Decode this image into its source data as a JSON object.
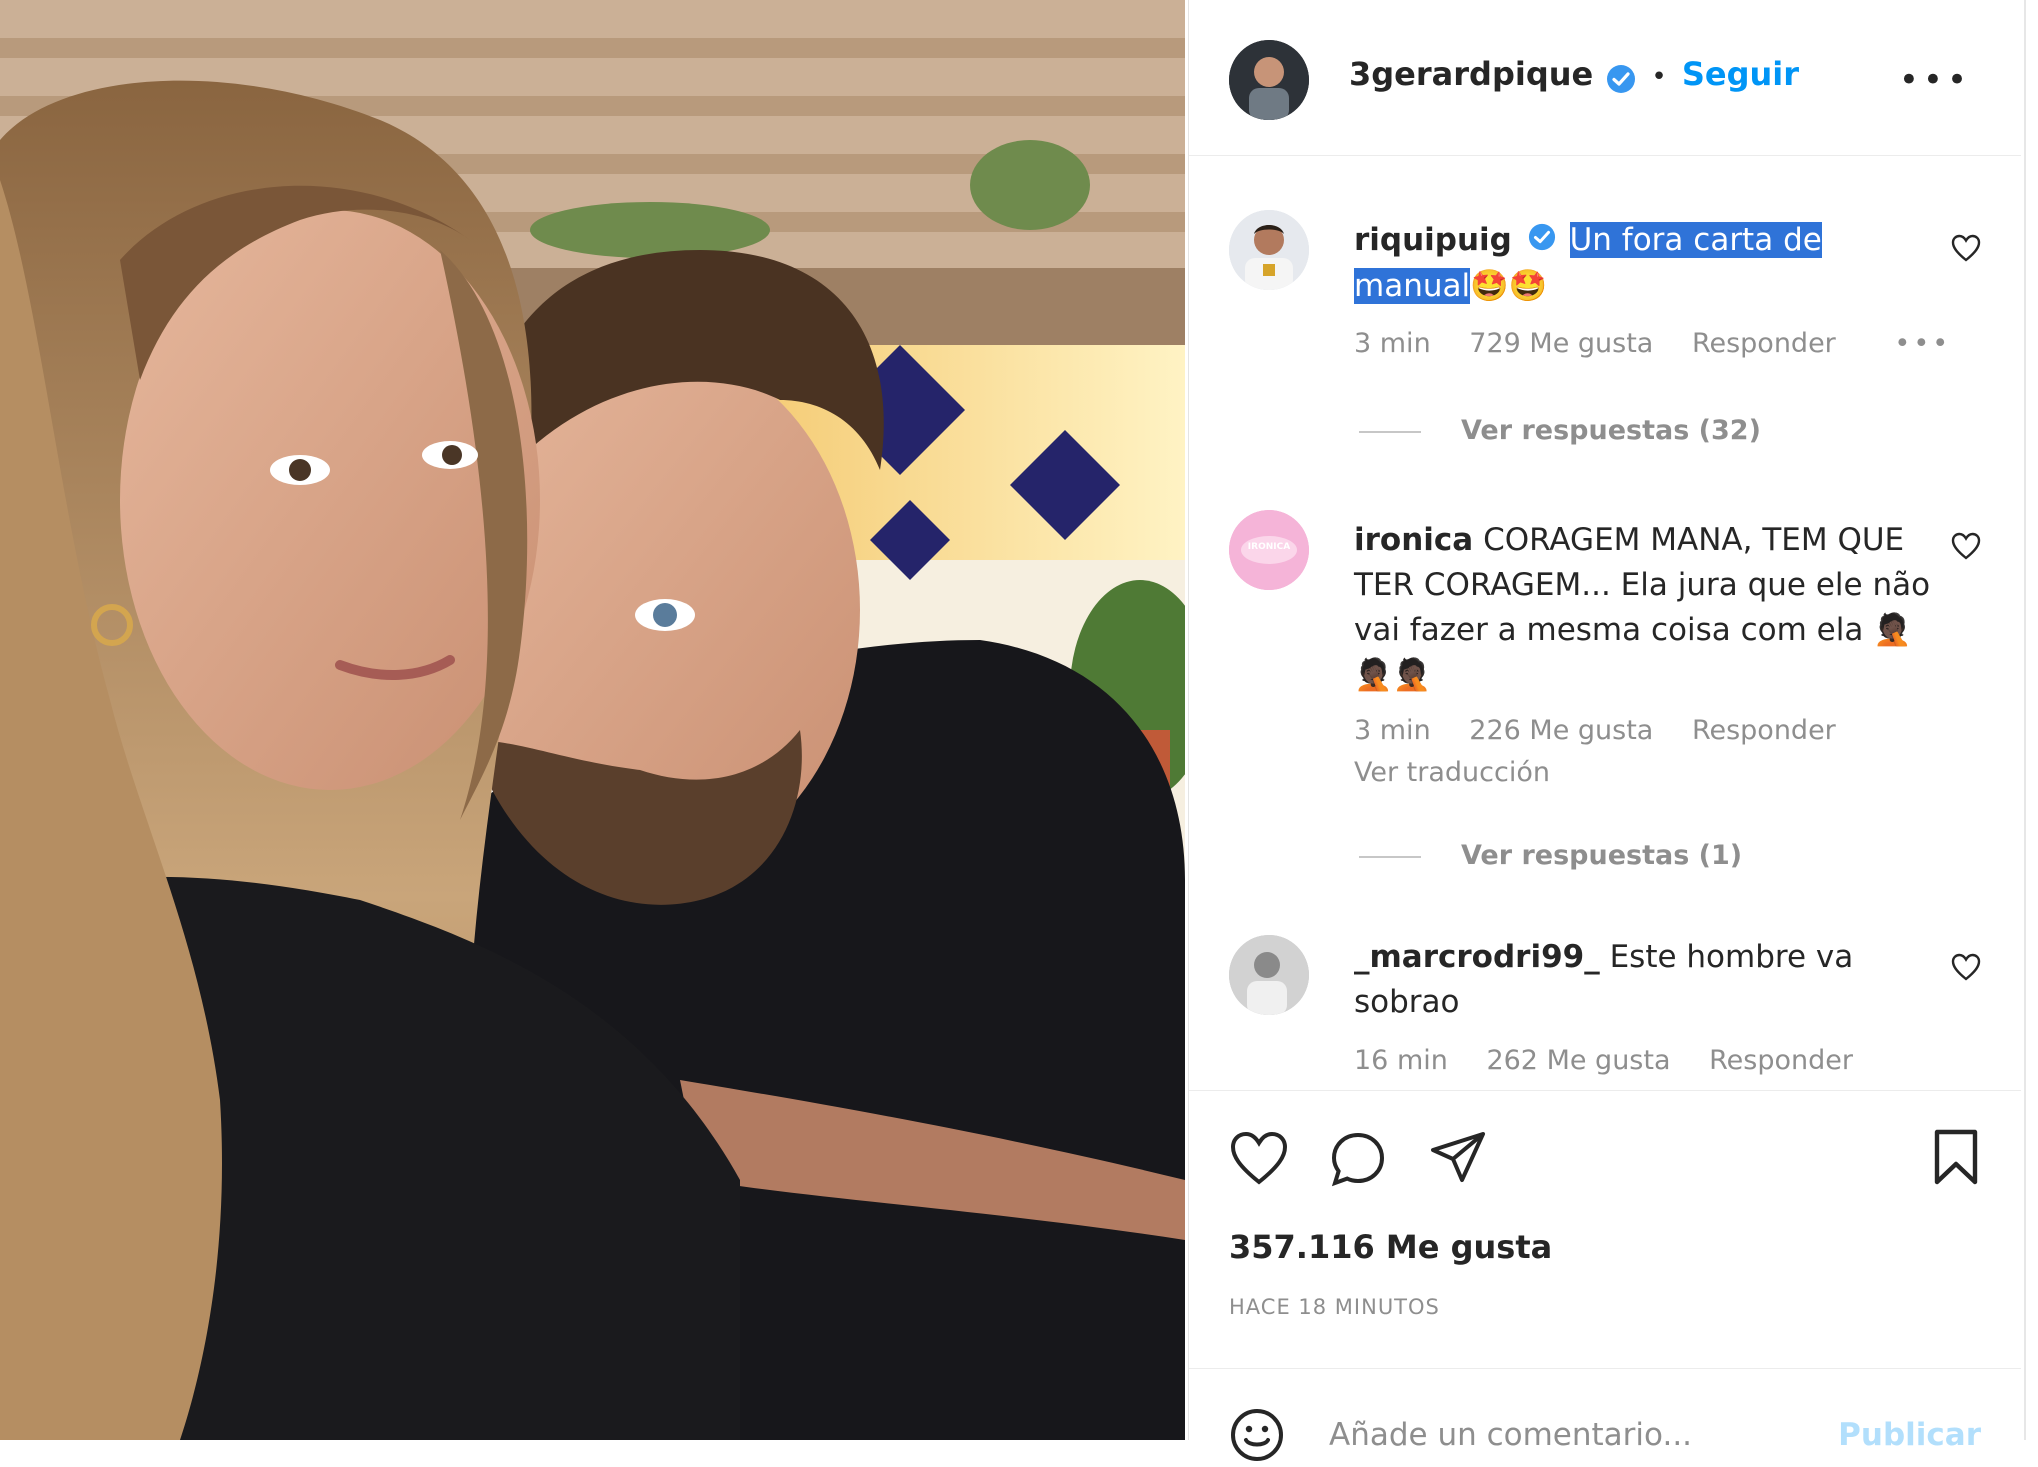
{
  "post": {
    "author": "3gerardpique",
    "follow_label": "Seguir",
    "separator": "•",
    "more_label": "•••"
  },
  "comments": [
    {
      "user": "riquipuig",
      "verified": true,
      "text_highlighted": "Un fora carta de manual",
      "text_rest": "🤩🤩",
      "time": "3 min",
      "likes": "729 Me gusta",
      "reply_label": "Responder",
      "more_label": "•••",
      "view_replies": "Ver respuestas (32)"
    },
    {
      "user": "ironica",
      "verified": false,
      "text": "CORAGEM MANA, TEM QUE TER CORAGEM... Ela jura que ele não vai fazer a mesma coisa com ela 🤦🏿🤦🏿🤦🏿",
      "time": "3 min",
      "likes": "226 Me gusta",
      "reply_label": "Responder",
      "translate_label": "Ver traducción",
      "view_replies": "Ver respuestas (1)",
      "avatar_text": "IRONICA"
    },
    {
      "user": "_marcrodri99_",
      "verified": false,
      "text": "Este hombre va sobrao",
      "time": "16 min",
      "likes": "262 Me gusta",
      "reply_label": "Responder"
    }
  ],
  "stats": {
    "likes": "357.116 Me gusta",
    "time_ago": "HACE 18 MINUTOS"
  },
  "add_comment": {
    "placeholder": "Añade un comentario...",
    "publish_label": "Publicar"
  },
  "colors": {
    "link_blue": "#0095f6",
    "highlight": "#2f73d8",
    "muted": "#8e8e8e"
  }
}
